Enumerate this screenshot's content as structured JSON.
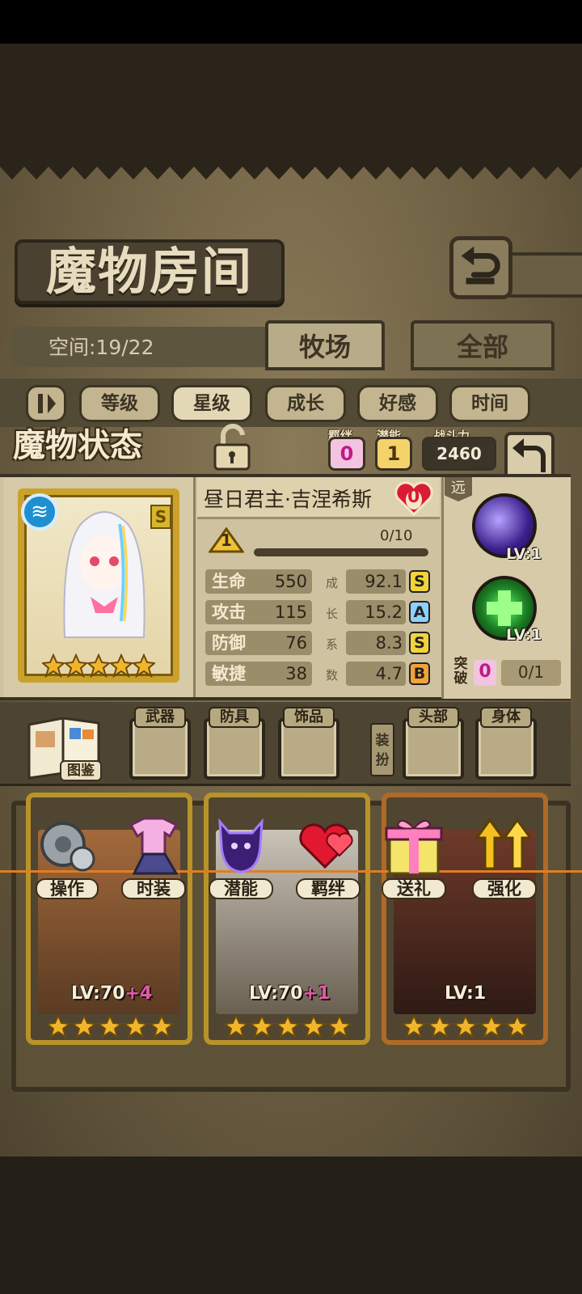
{
  "header": {
    "title": "魔物房间",
    "space_label": "空间:19/22",
    "tabs": [
      "牧场",
      "全部"
    ]
  },
  "sort": {
    "options": [
      "等级",
      "星级",
      "成长",
      "好感",
      "时间"
    ],
    "active": "星级"
  },
  "status": {
    "title": "魔物状态",
    "bond_label": "羁绊",
    "bond_value": "0",
    "potential_label": "潜能",
    "potential_value": "1",
    "power_label": "战斗力",
    "power_value": "2460"
  },
  "monster": {
    "name": "昼日君主·吉涅希斯",
    "affection": "0",
    "rank": "S",
    "element_icon": "water-wave-icon",
    "level": "1",
    "exp": "0/10",
    "exp_fraction": 0,
    "stars": 5,
    "stats": [
      {
        "name": "生命",
        "value": "550",
        "growth": "92.1",
        "grade": "S"
      },
      {
        "name": "攻击",
        "value": "115",
        "growth": "15.2",
        "grade": "A"
      },
      {
        "name": "防御",
        "value": "76",
        "growth": "8.3",
        "grade": "S"
      },
      {
        "name": "敏捷",
        "value": "38",
        "growth": "4.7",
        "grade": "B"
      }
    ],
    "growth_chars": [
      "成",
      "长",
      "系",
      "数"
    ]
  },
  "skills": {
    "range": "远",
    "items": [
      {
        "icon": "comet-skill-icon",
        "level": "LV:1"
      },
      {
        "icon": "heal-cross-skill-icon",
        "level": "LV:1"
      }
    ],
    "break_label": "突破",
    "break_count": "0",
    "break_progress": "0/1"
  },
  "equipment": {
    "book_label": "图鉴",
    "slots": [
      "武器",
      "防具",
      "饰品",
      "头部",
      "身体"
    ],
    "dress_tag": "装扮"
  },
  "actions": [
    "操作",
    "时装",
    "潜能",
    "羁绊",
    "送礼",
    "强化"
  ],
  "monster_cards": [
    {
      "level": "LV:70",
      "plus": "+4"
    },
    {
      "level": "LV:70",
      "plus": "+1"
    },
    {
      "level": "LV:1",
      "plus": ""
    }
  ],
  "colors": {
    "panel": "#cfc2a0",
    "frame_gold": "#caa22a",
    "accent_orange": "#e07d22",
    "grade_S": "#f2d43a",
    "grade_A": "#8fd0ff",
    "grade_B": "#f2a23a"
  }
}
